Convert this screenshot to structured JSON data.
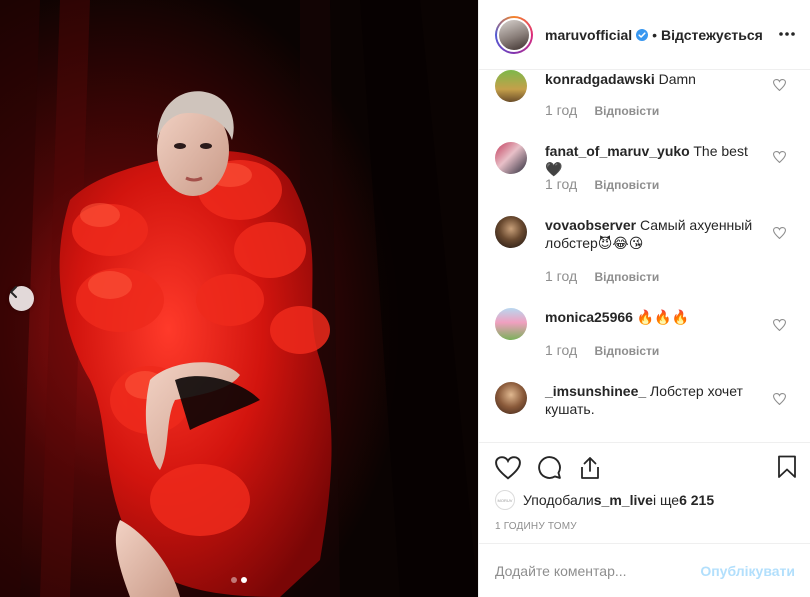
{
  "header": {
    "username": "maruvofficial",
    "separator": "•",
    "follow_status": "Відстежується",
    "verified_icon": "verified-badge-icon",
    "more_icon": "more-options-icon"
  },
  "comments": [
    {
      "username": "konradgadawski",
      "text": "Damn",
      "time": "1 год",
      "reply": "Відповісти"
    },
    {
      "username": "fanat_of_maruv_yuko",
      "text": "The best🖤",
      "time": "1 год",
      "reply": "Відповісти"
    },
    {
      "username": "vovaobserver",
      "text": "Самый ахуенный лобстер😈😂😘",
      "time": "1 год",
      "reply": "Відповісти"
    },
    {
      "username": "monica25966",
      "text": "🔥🔥🔥",
      "time": "1 год",
      "reply": "Відповісти"
    },
    {
      "username": "_imsunshinee_",
      "text": "Лобстер хочет кушать.",
      "time": "",
      "reply": ""
    }
  ],
  "actions": {
    "like_icon": "heart-icon",
    "comment_icon": "comment-icon",
    "share_icon": "share-icon",
    "save_icon": "bookmark-icon"
  },
  "likes": {
    "avatar_text": "MORUV",
    "prefix": "Уподобали ",
    "user": "s_m_live",
    "middle": " і ще ",
    "count": "6 215"
  },
  "time_ago": "1 ГОДИНУ ТОМУ",
  "add_comment": {
    "placeholder": "Додайте коментар...",
    "publish_label": "Опублікувати"
  },
  "carousel": {
    "prev_icon": "chevron-left-icon",
    "total": 2,
    "active": 2
  },
  "colors": {
    "verified": "#3897f0",
    "publish_disabled": "#b2dffc",
    "meta_text": "#8e8e8e"
  }
}
